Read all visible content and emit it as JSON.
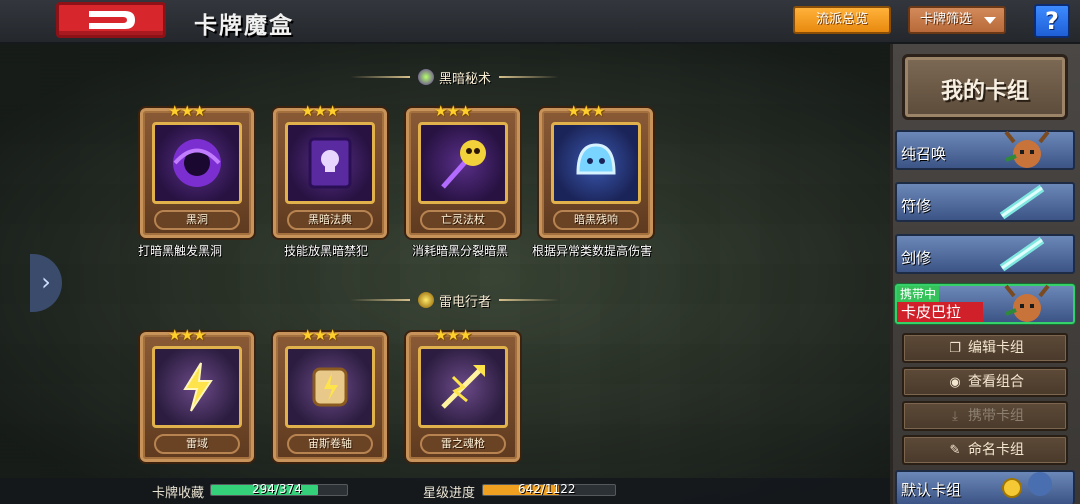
{
  "header": {
    "title": "卡牌魔盒",
    "overview_button": "流派总览",
    "filter_button": "卡牌筛选",
    "help_button": "?"
  },
  "sections": [
    {
      "title": "黑暗秘术",
      "cards": [
        {
          "name": "黑洞",
          "stars": 3,
          "description": "打暗黑触发黑洞"
        },
        {
          "name": "黑暗法典",
          "stars": 3,
          "description": "技能放黑暗禁犯"
        },
        {
          "name": "亡灵法杖",
          "stars": 3,
          "description": "消耗暗黑分裂暗黑"
        },
        {
          "name": "暗黑残响",
          "stars": 3,
          "description": "根据异常类数提高伤害"
        }
      ]
    },
    {
      "title": "雷电行者",
      "cards": [
        {
          "name": "雷域",
          "stars": 3
        },
        {
          "name": "宙斯卷轴",
          "stars": 3
        },
        {
          "name": "雷之魂枪",
          "stars": 3
        }
      ]
    }
  ],
  "stats": {
    "collection_label": "卡牌收藏",
    "collection_value": "294/374",
    "collection_fraction": 0.786,
    "star_label": "星级进度",
    "star_value": "642/1122",
    "star_fraction": 0.572
  },
  "deck_panel": {
    "title": "我的卡组",
    "decks": [
      {
        "name": "纯召唤",
        "active": false
      },
      {
        "name": "符修",
        "active": false
      },
      {
        "name": "剑修",
        "active": false
      },
      {
        "name": "卡皮巴拉",
        "active": true,
        "tag": "携带中"
      },
      {
        "name": "默认卡组",
        "active": false
      }
    ],
    "actions": {
      "edit": "编辑卡组",
      "view": "查看组合",
      "carry": "携带卡组",
      "rename": "命名卡组"
    }
  },
  "colors": {
    "accent_orange": "#f0a020",
    "bar_green": "#35d07a",
    "bar_orange": "#f0a020",
    "active_tag": "#35c25a"
  }
}
